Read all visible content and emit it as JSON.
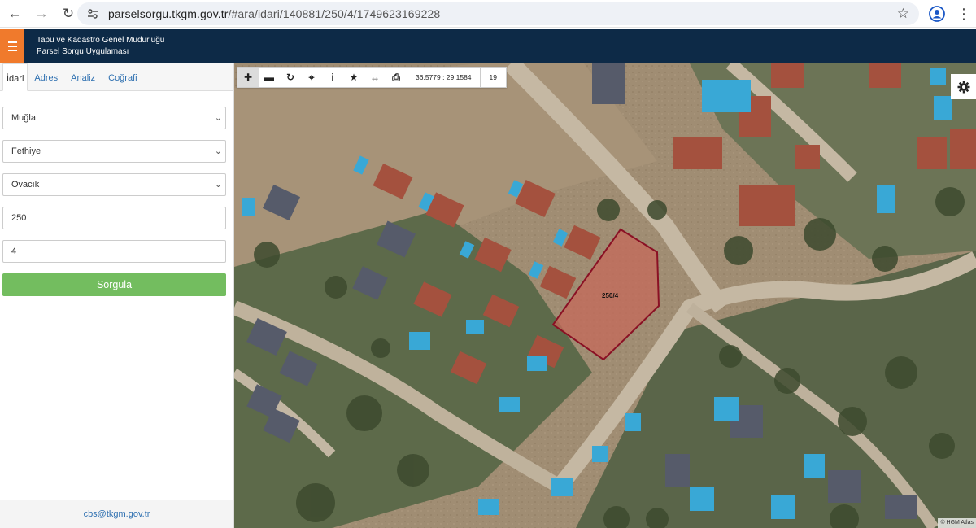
{
  "browser": {
    "url_prefix": "parselsorgu.tkgm.gov.tr",
    "url_suffix": "/#ara/idari/140881/250/4/1749623169228"
  },
  "header": {
    "title_line1": "Tapu ve Kadastro Genel Müdürlüğü",
    "title_line2": "Parsel Sorgu Uygulaması",
    "accent_color": "#f07a2c",
    "bg_color": "#0d2a47"
  },
  "sidebar": {
    "tabs": [
      {
        "label": "İdari"
      },
      {
        "label": "Adres"
      },
      {
        "label": "Analiz"
      },
      {
        "label": "Coğrafi"
      }
    ],
    "fields": {
      "province": "Muğla",
      "district": "Fethiye",
      "neighborhood": "Ovacık",
      "block": "250",
      "parcel": "4"
    },
    "submit_label": "Sorgula",
    "submit_color": "#73bd5f",
    "footer_email": "cbs@tkgm.gov.tr"
  },
  "map": {
    "toolbar": {
      "tools": [
        "plus-icon",
        "minus-icon",
        "refresh-icon",
        "crosshair-icon",
        "info-icon",
        "star-icon",
        "measure-icon",
        "print-icon"
      ],
      "coordinates": "36.5779 : 29.1584",
      "zoom": "19"
    },
    "parcel_label": "250/4",
    "attribution": "© HGM Atlas"
  }
}
